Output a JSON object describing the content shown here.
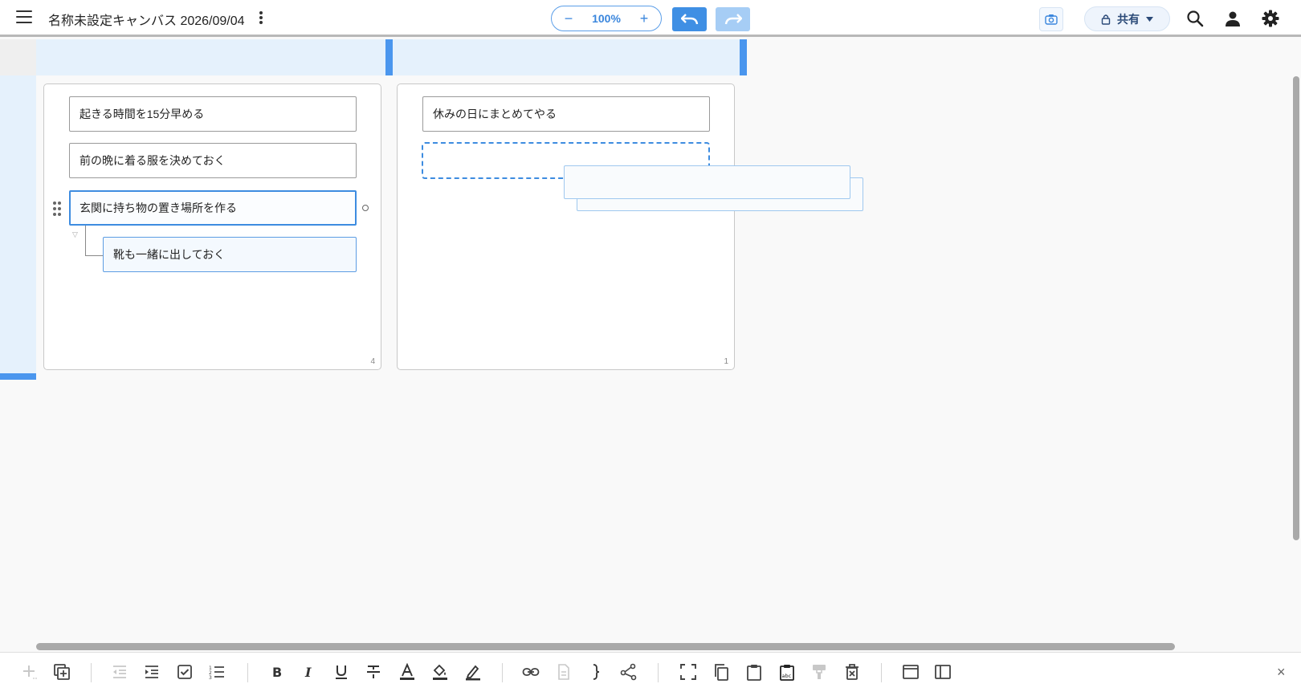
{
  "header": {
    "title": "名称未設定キャンバス 2026/09/04",
    "zoom": {
      "minus": "−",
      "value": "100%",
      "plus": "+"
    },
    "share_label": "共有"
  },
  "panels": [
    {
      "count": "4",
      "cards": [
        {
          "text": "起きる時間を15分早める"
        },
        {
          "text": "前の晩に着る服を決めておく"
        },
        {
          "text": "玄関に持ち物の置き場所を作る",
          "selected": true
        },
        {
          "text": "靴も一緒に出しておく",
          "child": true
        }
      ]
    },
    {
      "count": "1",
      "cards": [
        {
          "text": "休みの日にまとめてやる"
        }
      ]
    }
  ],
  "toolbar": {
    "close": "×"
  },
  "colors": {
    "accent": "#3d8ce0",
    "undo_bg": "#3f8fe4",
    "redo_bg": "#a6cdf5",
    "header_strip": "#e5f1fc"
  }
}
